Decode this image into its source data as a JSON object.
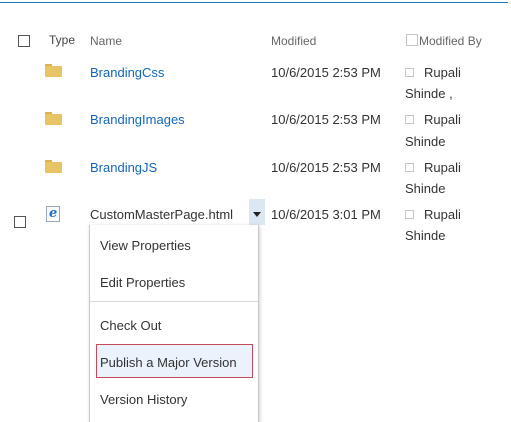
{
  "columns": {
    "type": "Type",
    "name": "Name",
    "modified": "Modified",
    "modified_by": "Modified By"
  },
  "rows": [
    {
      "type_icon": "folder-icon",
      "name": "BrandingCss",
      "modified": "10/6/2015 2:53 PM",
      "modified_by_line1": "Rupali",
      "modified_by_line2": "Shinde ,"
    },
    {
      "type_icon": "folder-icon",
      "name": "BrandingImages",
      "modified": "10/6/2015 2:53 PM",
      "modified_by_line1": "Rupali",
      "modified_by_line2": "Shinde"
    },
    {
      "type_icon": "folder-icon",
      "name": "BrandingJS",
      "modified": "10/6/2015 2:53 PM",
      "modified_by_line1": "Rupali",
      "modified_by_line2": "Shinde"
    },
    {
      "type_icon": "html-file-icon",
      "name": "CustomMasterPage.html",
      "modified": "10/6/2015 3:01 PM",
      "modified_by_line1": "Rupali",
      "modified_by_line2": "Shinde"
    }
  ],
  "context_menu": {
    "items": [
      {
        "label": "View Properties"
      },
      {
        "label": "Edit Properties"
      },
      {
        "label": "Check Out"
      },
      {
        "label": "Publish a Major Version"
      },
      {
        "label": "Version History"
      }
    ]
  },
  "colors": {
    "link": "#1166bb",
    "accent_rule": "#1b78c4",
    "highlight_border": "#c24a5a",
    "folder": "#e9c466"
  }
}
